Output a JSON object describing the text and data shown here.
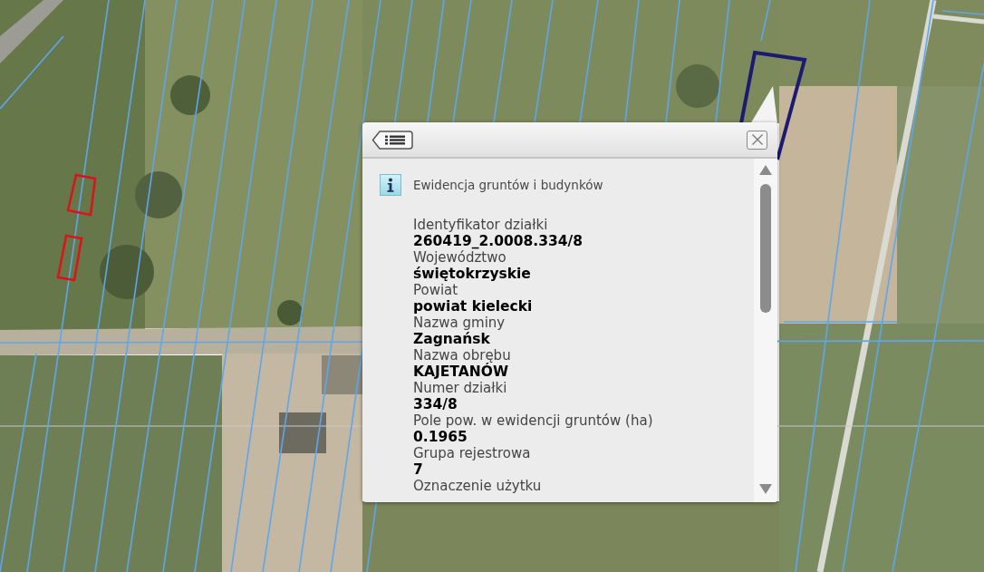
{
  "popup": {
    "section_title": "Ewidencja gruntów i budynków",
    "fields": [
      {
        "label": "Identyfikator działki",
        "value": "260419_2.0008.334/8"
      },
      {
        "label": "Województwo",
        "value": "świętokrzyskie"
      },
      {
        "label": "Powiat",
        "value": "powiat kielecki"
      },
      {
        "label": "Nazwa gminy",
        "value": "Zagnańsk"
      },
      {
        "label": "Nazwa obrębu",
        "value": "KAJETANÓW"
      },
      {
        "label": "Numer działki",
        "value": "334/8"
      },
      {
        "label": "Pole pow. w ewidencji gruntów (ha)",
        "value": "0.1965"
      },
      {
        "label": "Grupa rejestrowa",
        "value": "7"
      },
      {
        "label": "Oznaczenie użytku"
      }
    ]
  }
}
